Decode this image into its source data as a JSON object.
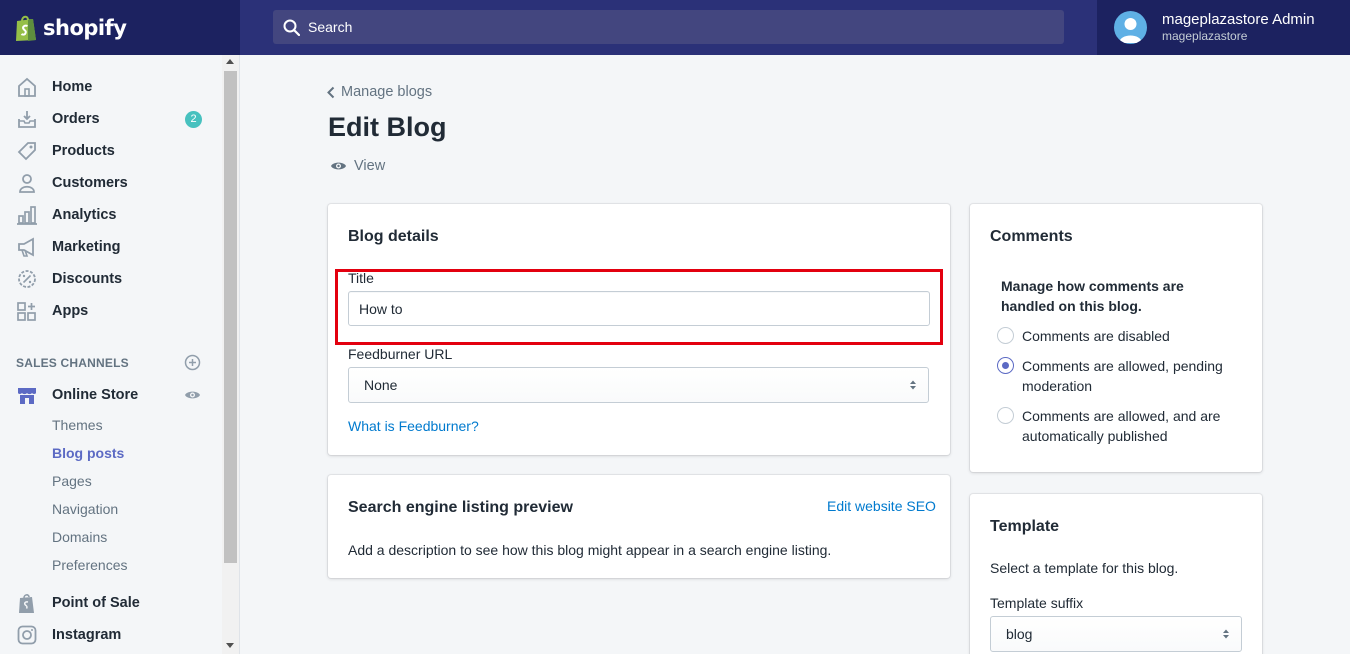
{
  "app": {
    "brand": "shopify",
    "search_placeholder": "Search",
    "user": {
      "name": "mageplazastore Admin",
      "store": "mageplazastore"
    }
  },
  "sidebar": {
    "items": [
      {
        "label": "Home",
        "icon": "home-icon"
      },
      {
        "label": "Orders",
        "icon": "orders-icon",
        "badge": "2"
      },
      {
        "label": "Products",
        "icon": "tag-icon"
      },
      {
        "label": "Customers",
        "icon": "person-icon"
      },
      {
        "label": "Analytics",
        "icon": "bar-chart-icon"
      },
      {
        "label": "Marketing",
        "icon": "megaphone-icon"
      },
      {
        "label": "Discounts",
        "icon": "discount-icon"
      },
      {
        "label": "Apps",
        "icon": "apps-icon"
      }
    ],
    "sales_channels_heading": "SALES CHANNELS",
    "online_store": {
      "label": "Online Store",
      "sub_items": [
        "Themes",
        "Blog posts",
        "Pages",
        "Navigation",
        "Domains",
        "Preferences"
      ],
      "active": "Blog posts"
    },
    "point_of_sale": "Point of Sale",
    "instagram": "Instagram"
  },
  "main": {
    "breadcrumb": "Manage blogs",
    "title": "Edit Blog",
    "view_label": "View",
    "blog_details": {
      "heading": "Blog details",
      "title_label": "Title",
      "title_value": "How to",
      "feedburner_label": "Feedburner URL",
      "feedburner_value": "None",
      "feedburner_help": "What is Feedburner?"
    },
    "seo": {
      "heading": "Search engine listing preview",
      "edit_link": "Edit website SEO",
      "description": "Add a description to see how this blog might appear in a search engine listing."
    },
    "comments": {
      "heading": "Comments",
      "intro": "Manage how comments are handled on this blog.",
      "options": [
        {
          "label": "Comments are disabled",
          "checked": false
        },
        {
          "label": "Comments are allowed, pending moderation",
          "checked": true
        },
        {
          "label": "Comments are allowed, and are automatically published",
          "checked": false
        }
      ]
    },
    "template": {
      "heading": "Template",
      "description": "Select a template for this blog.",
      "suffix_label": "Template suffix",
      "suffix_value": "blog"
    }
  },
  "colors": {
    "topbar": "#1c2260",
    "search_zone": "#2b3178",
    "accent": "#5c6ac4",
    "link": "#007ace",
    "badge": "#47c1bf",
    "highlight": "#e3000f"
  }
}
